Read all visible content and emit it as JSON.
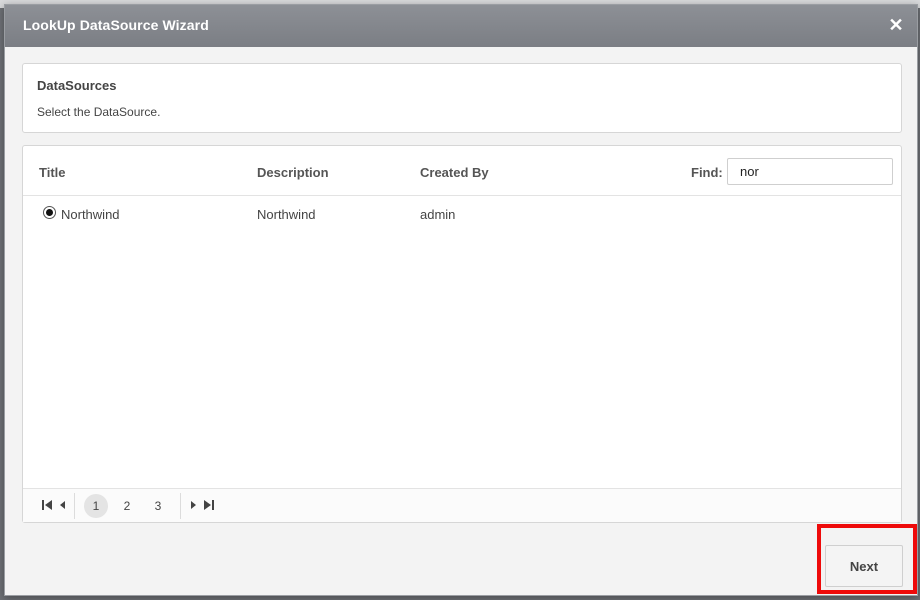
{
  "dialog": {
    "title": "LookUp DataSource Wizard",
    "close_icon": "close-icon"
  },
  "header": {
    "title": "DataSources",
    "subtitle": "Select the DataSource."
  },
  "grid": {
    "columns": [
      "Title",
      "Description",
      "Created By"
    ],
    "find_label": "Find:",
    "find_value": "nor",
    "rows": [
      {
        "title": "Northwind",
        "description": "Northwind",
        "created_by": "admin",
        "selected": true
      }
    ]
  },
  "pager": {
    "pages": [
      "1",
      "2",
      "3"
    ],
    "current_page": "1",
    "icons": [
      "first-page-icon",
      "prev-page-icon",
      "next-page-icon",
      "last-page-icon"
    ]
  },
  "footer": {
    "next_label": "Next",
    "highlight_color": "#ee0a0a"
  }
}
